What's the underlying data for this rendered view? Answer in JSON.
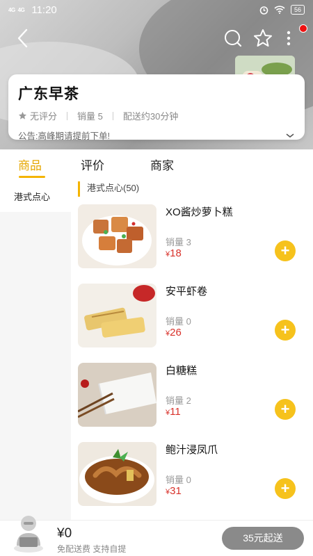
{
  "status_bar": {
    "signal1": "4G",
    "signal2": "4G",
    "time": "11:20",
    "battery": "56"
  },
  "shop": {
    "name": "广东早茶",
    "rating": "无评分",
    "sales": "销量 5",
    "delivery": "配送约30分钟",
    "notice": "公告:高峰期请提前下单!"
  },
  "tabs": [
    {
      "label": "商品",
      "active": true
    },
    {
      "label": "评价",
      "active": false
    },
    {
      "label": "商家",
      "active": false
    }
  ],
  "sidebar": {
    "items": [
      {
        "label": "港式点心"
      }
    ]
  },
  "category_header": "港式点心(50)",
  "products": [
    {
      "name": "XO酱炒萝卜糕",
      "sales": "销量 3",
      "currency": "¥",
      "price": "18"
    },
    {
      "name": "安平虾卷",
      "sales": "销量 0",
      "currency": "¥",
      "price": "26"
    },
    {
      "name": "白糖糕",
      "sales": "销量 2",
      "currency": "¥",
      "price": "11"
    },
    {
      "name": "鲍汁浸凤爪",
      "sales": "销量 0",
      "currency": "¥",
      "price": "31"
    }
  ],
  "add_label": "+",
  "cart": {
    "total": "¥0",
    "subtitle": "免配送费 支持自提",
    "checkout_label": "35元起送"
  },
  "colors": {
    "accent": "#f4b400",
    "price": "#d8312a",
    "checkout_disabled": "#8a8a8a"
  }
}
